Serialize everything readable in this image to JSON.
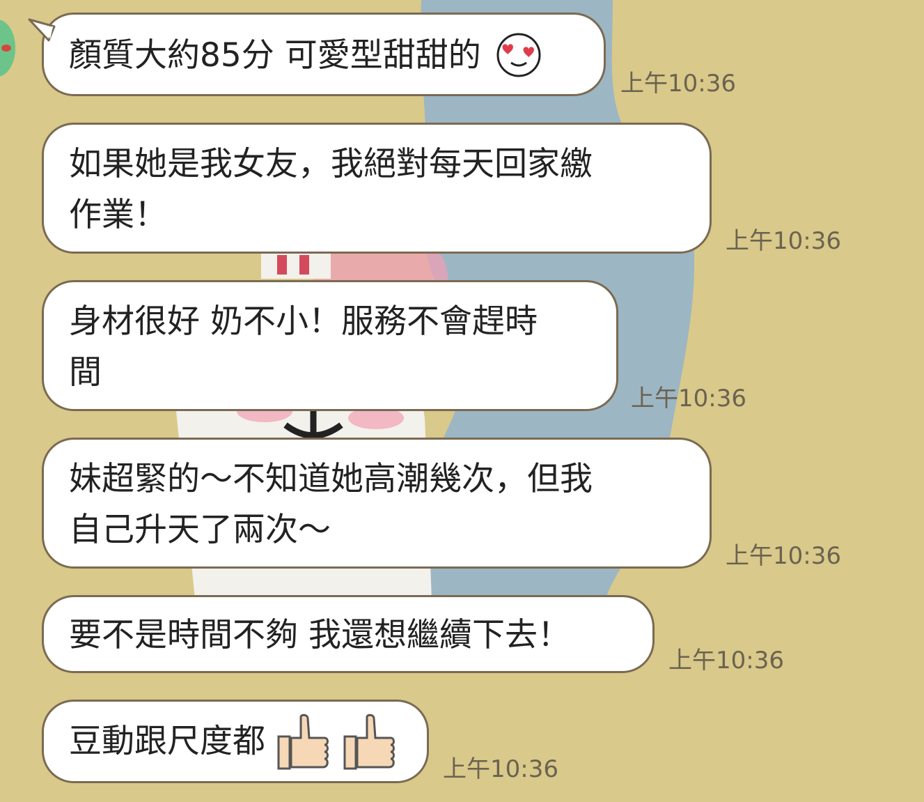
{
  "colors": {
    "background": "#d9c98a",
    "bubble": "#ffffff",
    "bubble_border": "#7a6a52",
    "timestamp": "#6b6250",
    "avatar": "#6cc48a"
  },
  "messages": [
    {
      "lines": [
        "顏質大約85分 可愛型甜甜的"
      ],
      "emoji": "heart-eyes-face-icon",
      "time": "上午10:36"
    },
    {
      "lines": [
        "如果她是我女友，我絕對每天回家繳",
        "作業！"
      ],
      "time": "上午10:36"
    },
    {
      "lines": [
        "身材很好 奶不小！服務不會趕時",
        "間"
      ],
      "time": "上午10:36"
    },
    {
      "lines": [
        "妹超緊的～不知道她高潮幾次，但我",
        "自己升天了兩次～"
      ],
      "time": "上午10:36"
    },
    {
      "lines": [
        "要不是時間不夠 我還想繼續下去！"
      ],
      "time": "上午10:36"
    },
    {
      "lines": [
        "豆動跟尺度都"
      ],
      "emoji": "thumbs-up-icon",
      "emoji_count": 2,
      "time": "上午10:36"
    }
  ]
}
